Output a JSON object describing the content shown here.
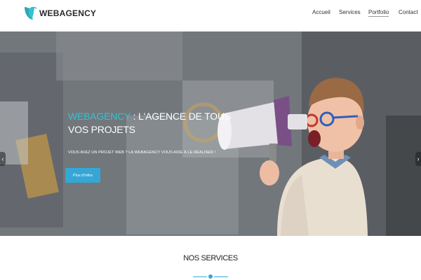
{
  "header": {
    "logo_text": "WEBAGENCY",
    "logo_icon": "bird-icon",
    "nav": [
      {
        "label": "Accueil"
      },
      {
        "label": "Services"
      },
      {
        "label": "Portfolio",
        "active": true
      },
      {
        "label": "Contact"
      }
    ]
  },
  "hero": {
    "title_brand": "WEBAGENCY",
    "title_line1_rest": " : L'AGENCE DE TOUS",
    "title_line2": "VOS PROJETS",
    "subtitle": "VOUS AVEZ UN PROJET WEB ? LA WEBAGENCY VOUS AIDE À LE RÉALISER !",
    "cta_label": "Plus d'infos",
    "prev_icon": "chevron-left-icon",
    "next_icon": "chevron-right-icon"
  },
  "services": {
    "title": "NOS SERVICES"
  },
  "colors": {
    "accent": "#35a7d6",
    "brand_teal": "#35c2cf",
    "text_dark": "#222222"
  }
}
